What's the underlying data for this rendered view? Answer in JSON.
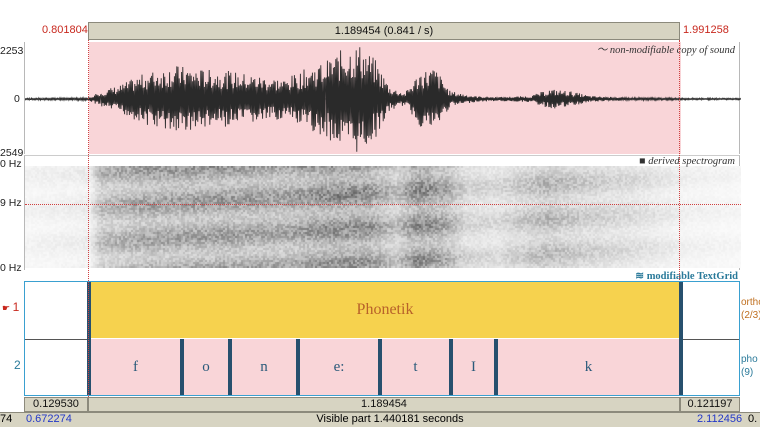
{
  "top_bar": {
    "left_time": "0.801804",
    "selection_label": "1.189454 (0.841 / s)",
    "right_time": "1.991258"
  },
  "waveform": {
    "caption": "non-modifiable copy of sound",
    "ymax_label": "2253",
    "zero_label": "0",
    "ymin_label": "2549"
  },
  "spectrogram": {
    "caption": "derived spectrogram",
    "top_label": "0 Hz",
    "cursor_label": "9 Hz",
    "bottom_label": "0 Hz"
  },
  "textgrid": {
    "caption": "modifiable TextGrid",
    "tier1": {
      "number": "1",
      "interval_text": "Phonetik",
      "name": "ortho",
      "count": "(2/3)"
    },
    "tier2": {
      "number": "2",
      "name": "pho",
      "count": "(9)",
      "segments": [
        "f",
        "o",
        "n",
        "e:",
        "t",
        "I",
        "k"
      ]
    }
  },
  "bottom_bar": {
    "left_duration": "0.129530",
    "selection_duration": "1.189454",
    "right_duration": "0.121197"
  },
  "status_bar": {
    "left_edge": "74",
    "visible_start": "0.672274",
    "visible_label": "Visible part 1.440181 seconds",
    "visible_end": "2.112456",
    "right_edge": "0."
  },
  "colors": {
    "selection_pink": "#f9d5d8",
    "interval_yellow": "#f6d24e",
    "boundary": "#27506e",
    "time_red": "#c8281e",
    "time_blue": "#2338c8",
    "textgrid_teal": "#2a7a9a"
  }
}
